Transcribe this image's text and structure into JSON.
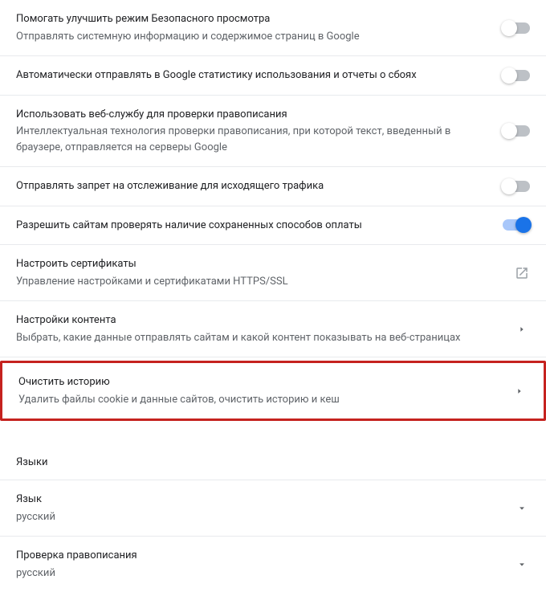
{
  "rows": [
    {
      "title": "Помогать улучшить режим Безопасного просмотра",
      "desc": "Отправлять системную информацию и содержимое страниц в Google",
      "type": "toggle",
      "on": false
    },
    {
      "title": "Автоматически отправлять в Google статистику использования и отчеты о сбоях",
      "desc": "",
      "type": "toggle",
      "on": false
    },
    {
      "title": "Использовать веб-службу для проверки правописания",
      "desc": "Интеллектуальная технология проверки правописания, при которой текст, введенный в браузере, отправляется на серверы Google",
      "type": "toggle",
      "on": false
    },
    {
      "title": "Отправлять запрет на отслеживание для исходящего трафика",
      "desc": "",
      "type": "toggle",
      "on": false
    },
    {
      "title": "Разрешить сайтам проверять наличие сохраненных способов оплаты",
      "desc": "",
      "type": "toggle",
      "on": true
    },
    {
      "title": "Настроить сертификаты",
      "desc": "Управление настройками и сертификатами HTTPS/SSL",
      "type": "external"
    },
    {
      "title": "Настройки контента",
      "desc": "Выбрать, какие данные отправлять сайтам и какой контент показывать на веб-страницах",
      "type": "link"
    },
    {
      "title": "Очистить историю",
      "desc": "Удалить файлы cookie и данные сайтов, очистить историю и кеш",
      "type": "link",
      "highlighted": true
    }
  ],
  "languages": {
    "header": "Языки",
    "items": [
      {
        "title": "Язык",
        "value": "русский"
      },
      {
        "title": "Проверка правописания",
        "value": "русский"
      }
    ]
  }
}
